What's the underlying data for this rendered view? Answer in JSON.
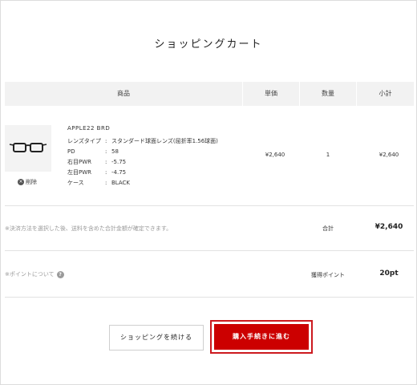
{
  "page": {
    "title": "ショッピングカート"
  },
  "table": {
    "headers": {
      "product": "商品",
      "unit_price": "単価",
      "quantity": "数量",
      "subtotal": "小計"
    }
  },
  "item": {
    "name": "APPLE22 BRD",
    "attributes": [
      {
        "key": "レンズタイプ",
        "value": "スタンダード球面レンズ(屈折率1.56球面)"
      },
      {
        "key": "PD",
        "value": "58"
      },
      {
        "key": "右目PWR",
        "value": "-5.75"
      },
      {
        "key": "左目PWR",
        "value": "-4.75"
      },
      {
        "key": "ケース",
        "value": "BLACK"
      }
    ],
    "separator": ":",
    "unit_price": "¥2,640",
    "quantity": "1",
    "subtotal": "¥2,640",
    "remove_label": "削除",
    "remove_icon": "×",
    "image_icon": "glasses-icon"
  },
  "summary": {
    "note": "※決済方法を選択した後、送料を含めた合計金額が確定できます。",
    "total_label": "合計",
    "total_value": "¥2,640"
  },
  "points": {
    "note": "※ポイントについて",
    "help_icon": "?",
    "label": "獲得ポイント",
    "value": "20pt"
  },
  "buttons": {
    "continue_label": "ショッピングを続ける",
    "checkout_label": "購入手続きに進む"
  },
  "colors": {
    "accent": "#cc0000",
    "header_bg": "#f2f2f2",
    "note": "#9a9a9a"
  }
}
